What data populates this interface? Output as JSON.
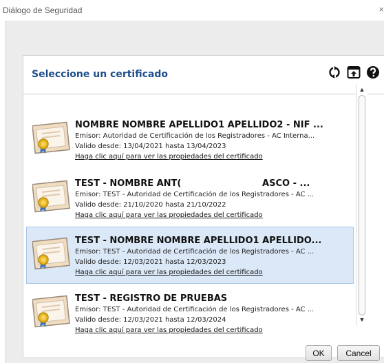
{
  "window": {
    "title": "Diálogo de Seguridad",
    "close_symbol": "×"
  },
  "header": {
    "title": "Seleccione un certificado",
    "icons": [
      "refresh-icon",
      "import-icon",
      "help-icon"
    ]
  },
  "certificates": [
    {
      "name": "NOMBRE NOMBRE APELLIDO1 APELLIDO2 - NIF ...",
      "issuer": "Emisor: Autoridad de Certificación de los Registradores - AC Interna...",
      "validity": "Valido desde: 13/04/2021 hasta 13/04/2023",
      "link": "Haga clic aquí para ver las propiedades del certificado",
      "selected": false
    },
    {
      "name": "TEST - NOMBRE ANT(                          ASCO - ...",
      "issuer": "Emisor: TEST - Autoridad de Certificación de los Registradores - AC ...",
      "validity": "Valido desde: 21/10/2020 hasta 21/10/2022",
      "link": "Haga clic aquí para ver las propiedades del certificado",
      "selected": false
    },
    {
      "name": "TEST - NOMBRE NOMBRE APELLIDO1 APELLIDO...",
      "issuer": "Emisor: TEST - Autoridad de Certificación de los Registradores - AC ...",
      "validity": "Valido desde: 12/03/2021 hasta 12/03/2023",
      "link": "Haga clic aquí para ver las propiedades del certificado",
      "selected": true
    },
    {
      "name": "TEST - REGISTRO DE PRUEBAS",
      "issuer": "Emisor: TEST - Autoridad de Certificación de los Registradores - AC ...",
      "validity": "Valido desde: 12/03/2021 hasta 12/03/2024",
      "link": "Haga clic aquí para ver las propiedades del certificado",
      "selected": false
    }
  ],
  "scrollbar": {
    "up": "▲",
    "down": "▼"
  },
  "buttons": {
    "ok": "OK",
    "cancel": "Cancel"
  },
  "colors": {
    "heading": "#1f4e8c",
    "selection": "#dbe8f7"
  }
}
